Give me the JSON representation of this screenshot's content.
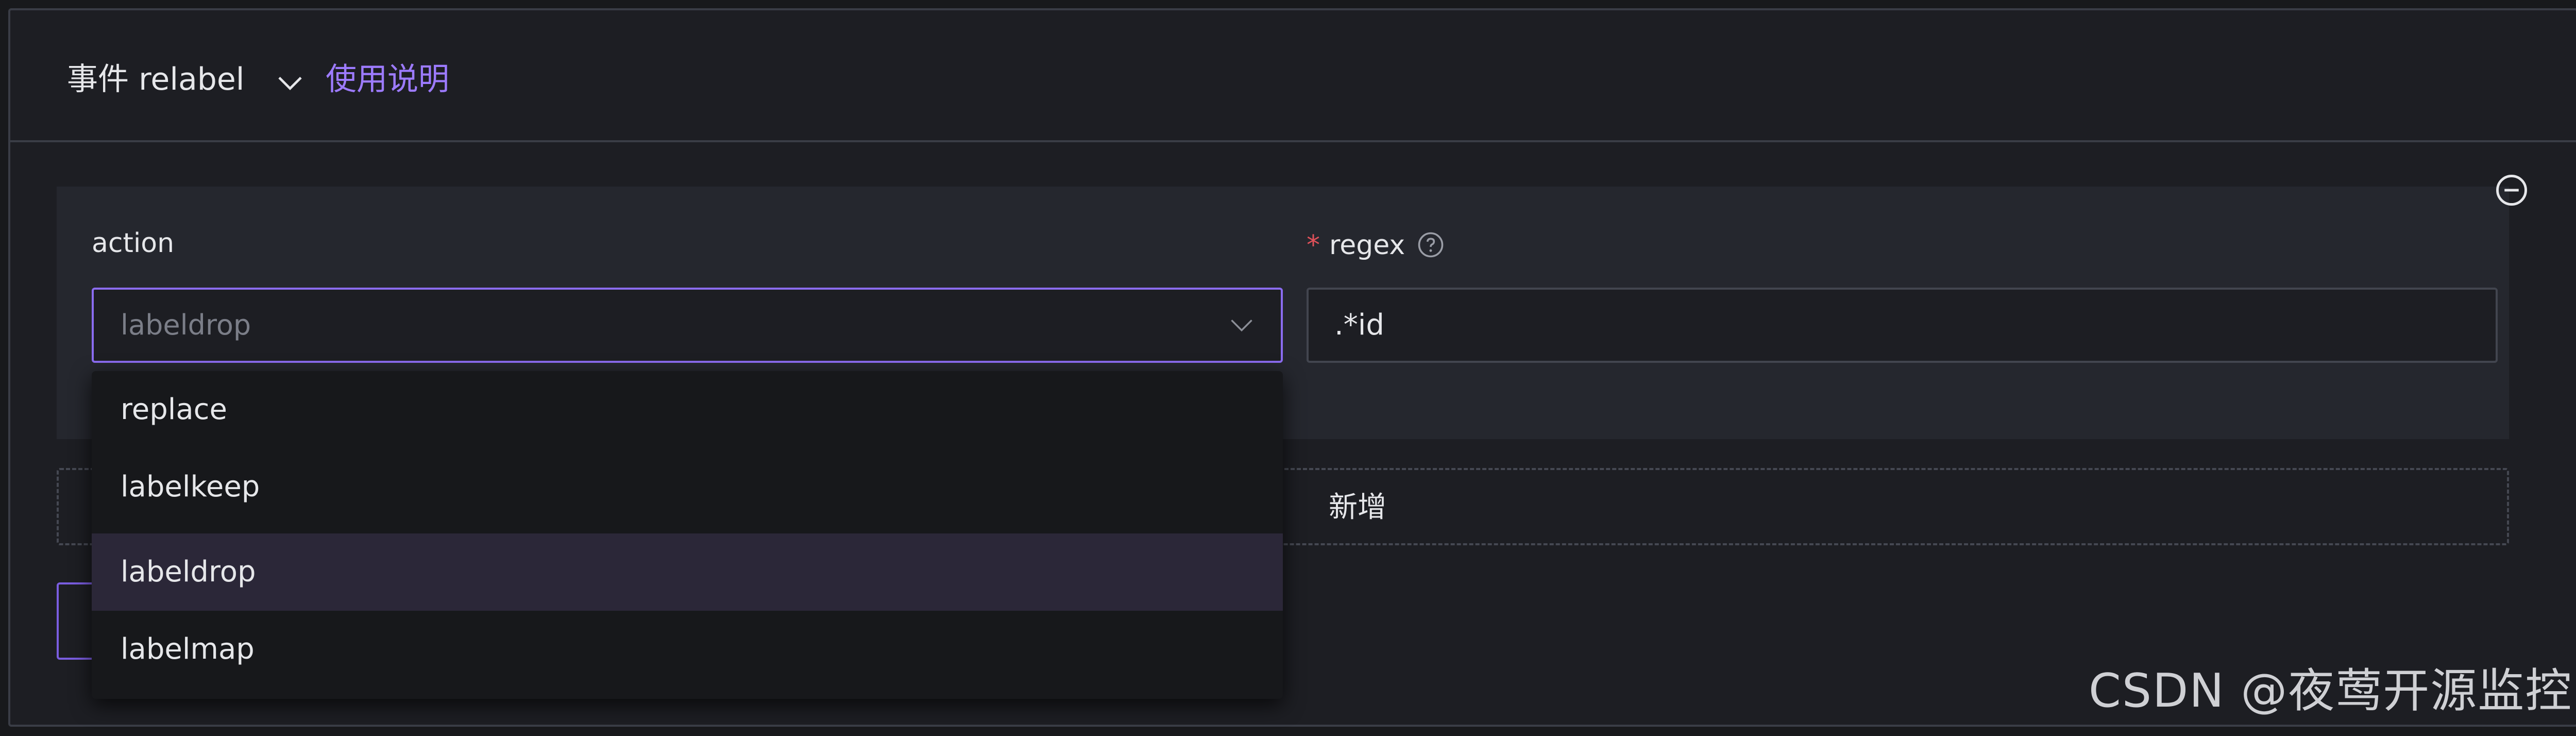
{
  "header": {
    "title": "事件 relabel",
    "help_link": "使用说明"
  },
  "rule": {
    "action": {
      "label": "action",
      "value": "labeldrop",
      "options": [
        "replace",
        "labelkeep",
        "labeldrop",
        "labelmap"
      ],
      "highlighted": "labeldrop"
    },
    "regex": {
      "required_mark": "*",
      "label": "regex",
      "value": ".*id"
    }
  },
  "add_label": "新增",
  "watermark": "CSDN @夜莺开源监控",
  "colors": {
    "accent": "#9d7bff",
    "select_border": "#8b6cf0",
    "required": "#e0515a",
    "highlight_row": "#2b2738"
  },
  "icons": {
    "expand": "chevron-down-icon",
    "select_arrow": "chevron-down-icon",
    "help": "question-circle-icon",
    "remove": "minus-circle-icon"
  }
}
